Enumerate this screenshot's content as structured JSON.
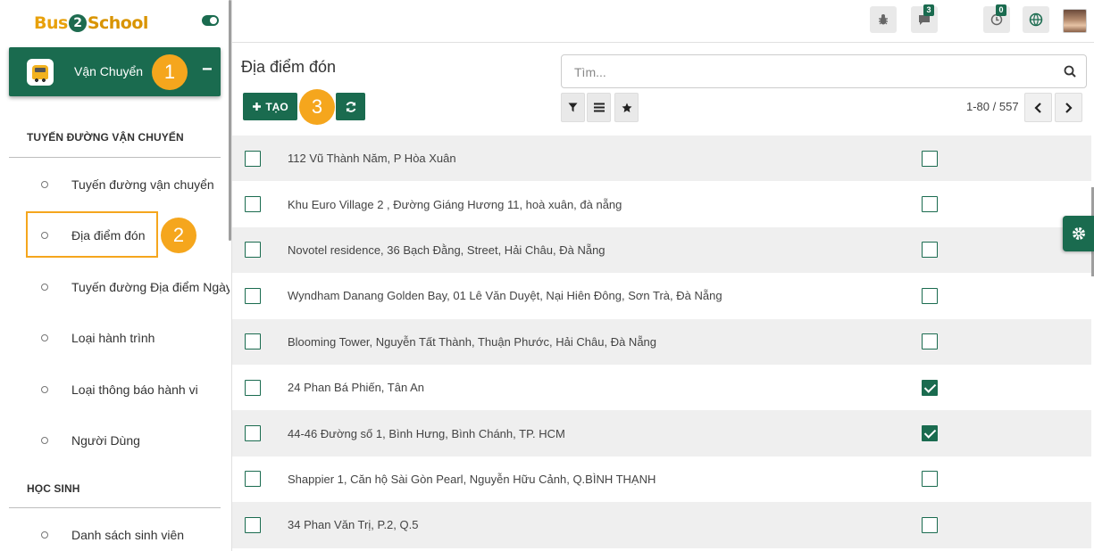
{
  "brand": {
    "part1": "Bus",
    "part2": "2",
    "part3": "School"
  },
  "app": {
    "name": "Vận Chuyển",
    "collapse": "−"
  },
  "annotations": {
    "one": "1",
    "two": "2",
    "three": "3"
  },
  "sidebar": {
    "section1_title": "TUYẾN ĐƯỜNG VẬN CHUYỂN",
    "section1_items": [
      "Tuyến đường vận chuyển",
      "Địa điểm đón",
      "Tuyến đường Địa điểm Ngày",
      "Loại hành trình",
      "Loại thông báo hành vi",
      "Người Dùng"
    ],
    "section2_title": "HỌC SINH",
    "section2_items": [
      "Danh sách sinh viên"
    ]
  },
  "topbar": {
    "messages_count": "3",
    "activity_count": "0"
  },
  "control": {
    "title": "Địa điểm đón",
    "search_placeholder": "Tìm...",
    "create_label": "TẠO",
    "pager": "1-80 / 557"
  },
  "list": [
    {
      "name": "112 Vũ Thành Năm, P Hòa Xuân",
      "checked": false
    },
    {
      "name": "Khu Euro Village 2 , Đường Giáng Hương 11, hoà xuân, đà nẵng",
      "checked": false
    },
    {
      "name": "Novotel residence, 36 Bạch Đằng, Street, Hải Châu, Đà Nẵng",
      "checked": false
    },
    {
      "name": "Wyndham Danang Golden Bay, 01 Lê Văn Duyệt, Nại Hiên Đông, Sơn Trà, Đà Nẵng",
      "checked": false
    },
    {
      "name": "Blooming Tower, Nguyễn Tất Thành, Thuận Phước, Hải Châu, Đà Nẵng",
      "checked": false
    },
    {
      "name": "24 Phan Bá Phiến, Tân An",
      "checked": true
    },
    {
      "name": "44-46 Đường số 1, Bình Hưng, Bình Chánh, TP. HCM",
      "checked": true
    },
    {
      "name": "Shappier 1, Căn hộ Sài Gòn Pearl, Nguyễn Hữu Cảnh, Q.BÌNH THẠNH",
      "checked": false
    },
    {
      "name": "34 Phan Văn Trị, P.2, Q.5",
      "checked": false
    }
  ],
  "colors": {
    "primary": "#1a6b4f",
    "accent": "#f5a61d",
    "brand_yellow": "#e8a10c"
  }
}
